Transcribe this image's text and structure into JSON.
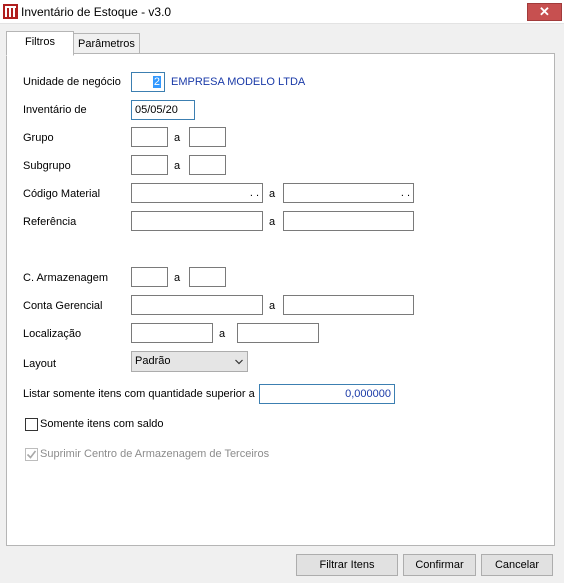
{
  "window": {
    "title": "Inventário de Estoque - v3.0",
    "close_label": "✕"
  },
  "tabs": [
    {
      "label": "Filtros"
    },
    {
      "label": "Parâmetros"
    }
  ],
  "fields": {
    "unidade": {
      "label": "Unidade de negócio",
      "code": "2",
      "name": "EMPRESA MODELO LTDA"
    },
    "inventario": {
      "label": "Inventário de",
      "value": "05/05/20"
    },
    "grupo": {
      "label": "Grupo",
      "separator": "a"
    },
    "subgrupo": {
      "label": "Subgrupo",
      "separator": "a"
    },
    "codigo": {
      "label": "Código Material",
      "separator": "a",
      "mask": ".  ."
    },
    "referencia": {
      "label": "Referência",
      "separator": "a"
    },
    "armazenagem": {
      "label": "C. Armazenagem",
      "separator": "a"
    },
    "conta": {
      "label": "Conta Gerencial",
      "separator": "a"
    },
    "localizacao": {
      "label": "Localização",
      "separator": "a"
    },
    "layout": {
      "label": "Layout",
      "value": "Padrão"
    },
    "quantidade": {
      "label": "Listar somente itens com quantidade superior a",
      "value": "0,000000"
    }
  },
  "checkboxes": {
    "somente_saldo": {
      "label": "Somente itens com saldo",
      "checked": false
    },
    "suprimir": {
      "label": "Suprimir Centro de Armazenagem de Terceiros",
      "checked": true,
      "disabled": true
    }
  },
  "buttons": {
    "filtrar": "Filtrar Itens",
    "confirmar": "Confirmar",
    "cancelar": "Cancelar"
  }
}
